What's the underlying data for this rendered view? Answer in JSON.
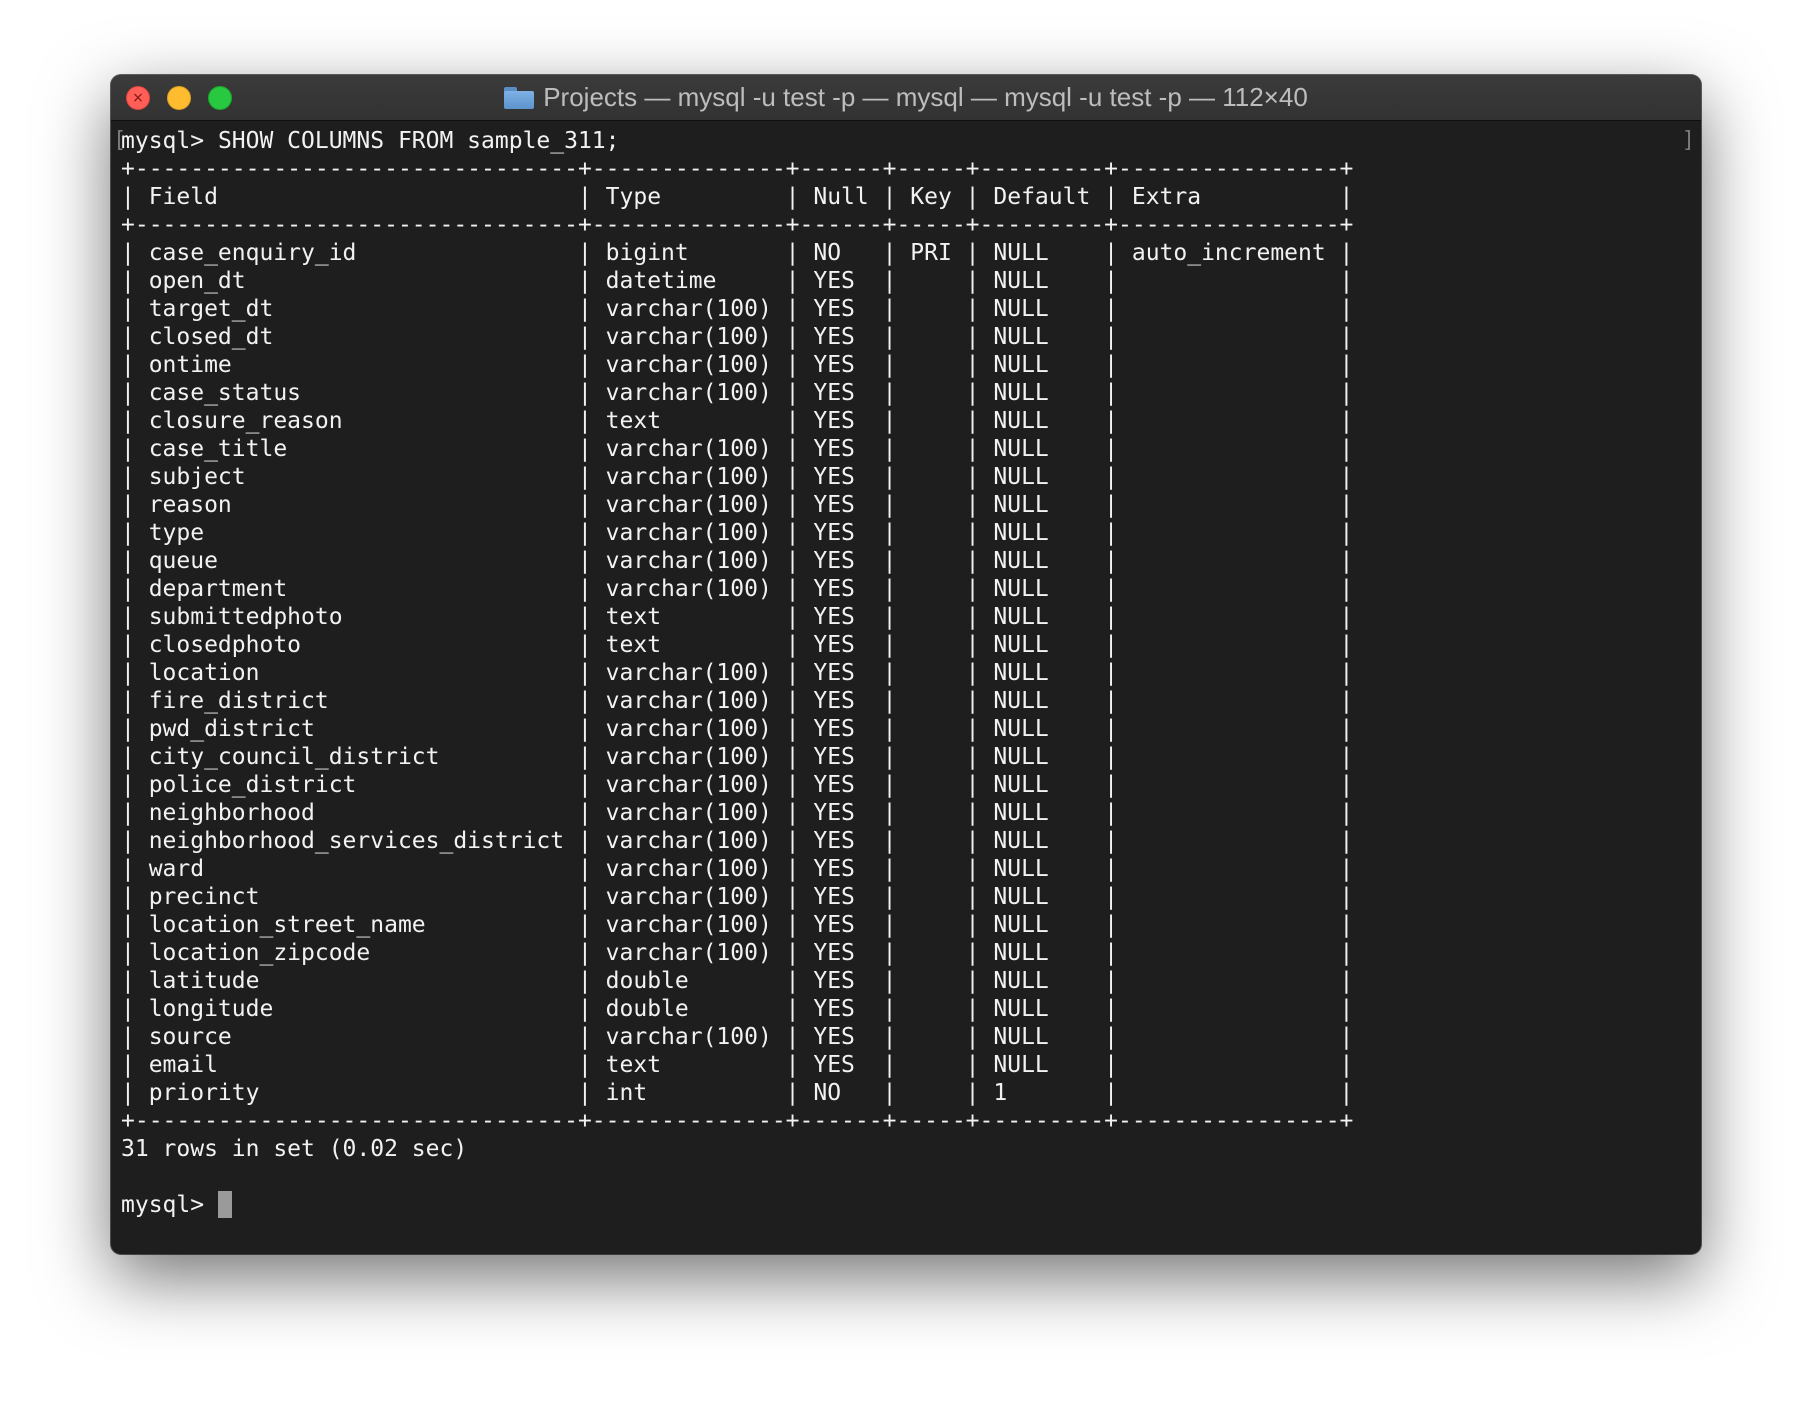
{
  "window": {
    "title": "Projects — mysql -u test -p — mysql — mysql -u test -p — 112×40",
    "folder_icon": "folder-icon"
  },
  "terminal": {
    "prompt_symbol": "mysql> ",
    "command": "SHOW COLUMNS FROM sample_311;",
    "table": {
      "columns": [
        "Field",
        "Type",
        "Null",
        "Key",
        "Default",
        "Extra"
      ],
      "rows": [
        [
          "case_enquiry_id",
          "bigint",
          "NO",
          "PRI",
          "NULL",
          "auto_increment"
        ],
        [
          "open_dt",
          "datetime",
          "YES",
          "",
          "NULL",
          ""
        ],
        [
          "target_dt",
          "varchar(100)",
          "YES",
          "",
          "NULL",
          ""
        ],
        [
          "closed_dt",
          "varchar(100)",
          "YES",
          "",
          "NULL",
          ""
        ],
        [
          "ontime",
          "varchar(100)",
          "YES",
          "",
          "NULL",
          ""
        ],
        [
          "case_status",
          "varchar(100)",
          "YES",
          "",
          "NULL",
          ""
        ],
        [
          "closure_reason",
          "text",
          "YES",
          "",
          "NULL",
          ""
        ],
        [
          "case_title",
          "varchar(100)",
          "YES",
          "",
          "NULL",
          ""
        ],
        [
          "subject",
          "varchar(100)",
          "YES",
          "",
          "NULL",
          ""
        ],
        [
          "reason",
          "varchar(100)",
          "YES",
          "",
          "NULL",
          ""
        ],
        [
          "type",
          "varchar(100)",
          "YES",
          "",
          "NULL",
          ""
        ],
        [
          "queue",
          "varchar(100)",
          "YES",
          "",
          "NULL",
          ""
        ],
        [
          "department",
          "varchar(100)",
          "YES",
          "",
          "NULL",
          ""
        ],
        [
          "submittedphoto",
          "text",
          "YES",
          "",
          "NULL",
          ""
        ],
        [
          "closedphoto",
          "text",
          "YES",
          "",
          "NULL",
          ""
        ],
        [
          "location",
          "varchar(100)",
          "YES",
          "",
          "NULL",
          ""
        ],
        [
          "fire_district",
          "varchar(100)",
          "YES",
          "",
          "NULL",
          ""
        ],
        [
          "pwd_district",
          "varchar(100)",
          "YES",
          "",
          "NULL",
          ""
        ],
        [
          "city_council_district",
          "varchar(100)",
          "YES",
          "",
          "NULL",
          ""
        ],
        [
          "police_district",
          "varchar(100)",
          "YES",
          "",
          "NULL",
          ""
        ],
        [
          "neighborhood",
          "varchar(100)",
          "YES",
          "",
          "NULL",
          ""
        ],
        [
          "neighborhood_services_district",
          "varchar(100)",
          "YES",
          "",
          "NULL",
          ""
        ],
        [
          "ward",
          "varchar(100)",
          "YES",
          "",
          "NULL",
          ""
        ],
        [
          "precinct",
          "varchar(100)",
          "YES",
          "",
          "NULL",
          ""
        ],
        [
          "location_street_name",
          "varchar(100)",
          "YES",
          "",
          "NULL",
          ""
        ],
        [
          "location_zipcode",
          "varchar(100)",
          "YES",
          "",
          "NULL",
          ""
        ],
        [
          "latitude",
          "double",
          "YES",
          "",
          "NULL",
          ""
        ],
        [
          "longitude",
          "double",
          "YES",
          "",
          "NULL",
          ""
        ],
        [
          "source",
          "varchar(100)",
          "YES",
          "",
          "NULL",
          ""
        ],
        [
          "email",
          "text",
          "YES",
          "",
          "NULL",
          ""
        ],
        [
          "priority",
          "int",
          "NO",
          "",
          "1",
          ""
        ]
      ]
    },
    "result_summary": "31 rows in set (0.02 sec)"
  },
  "colors": {
    "terminal_bg": "#1e1e1e",
    "terminal_text": "#f2f2f2",
    "titlebar_text": "#bdbdbd",
    "close": "#ff5f57",
    "minimize": "#febc2e",
    "zoom": "#28c840"
  }
}
